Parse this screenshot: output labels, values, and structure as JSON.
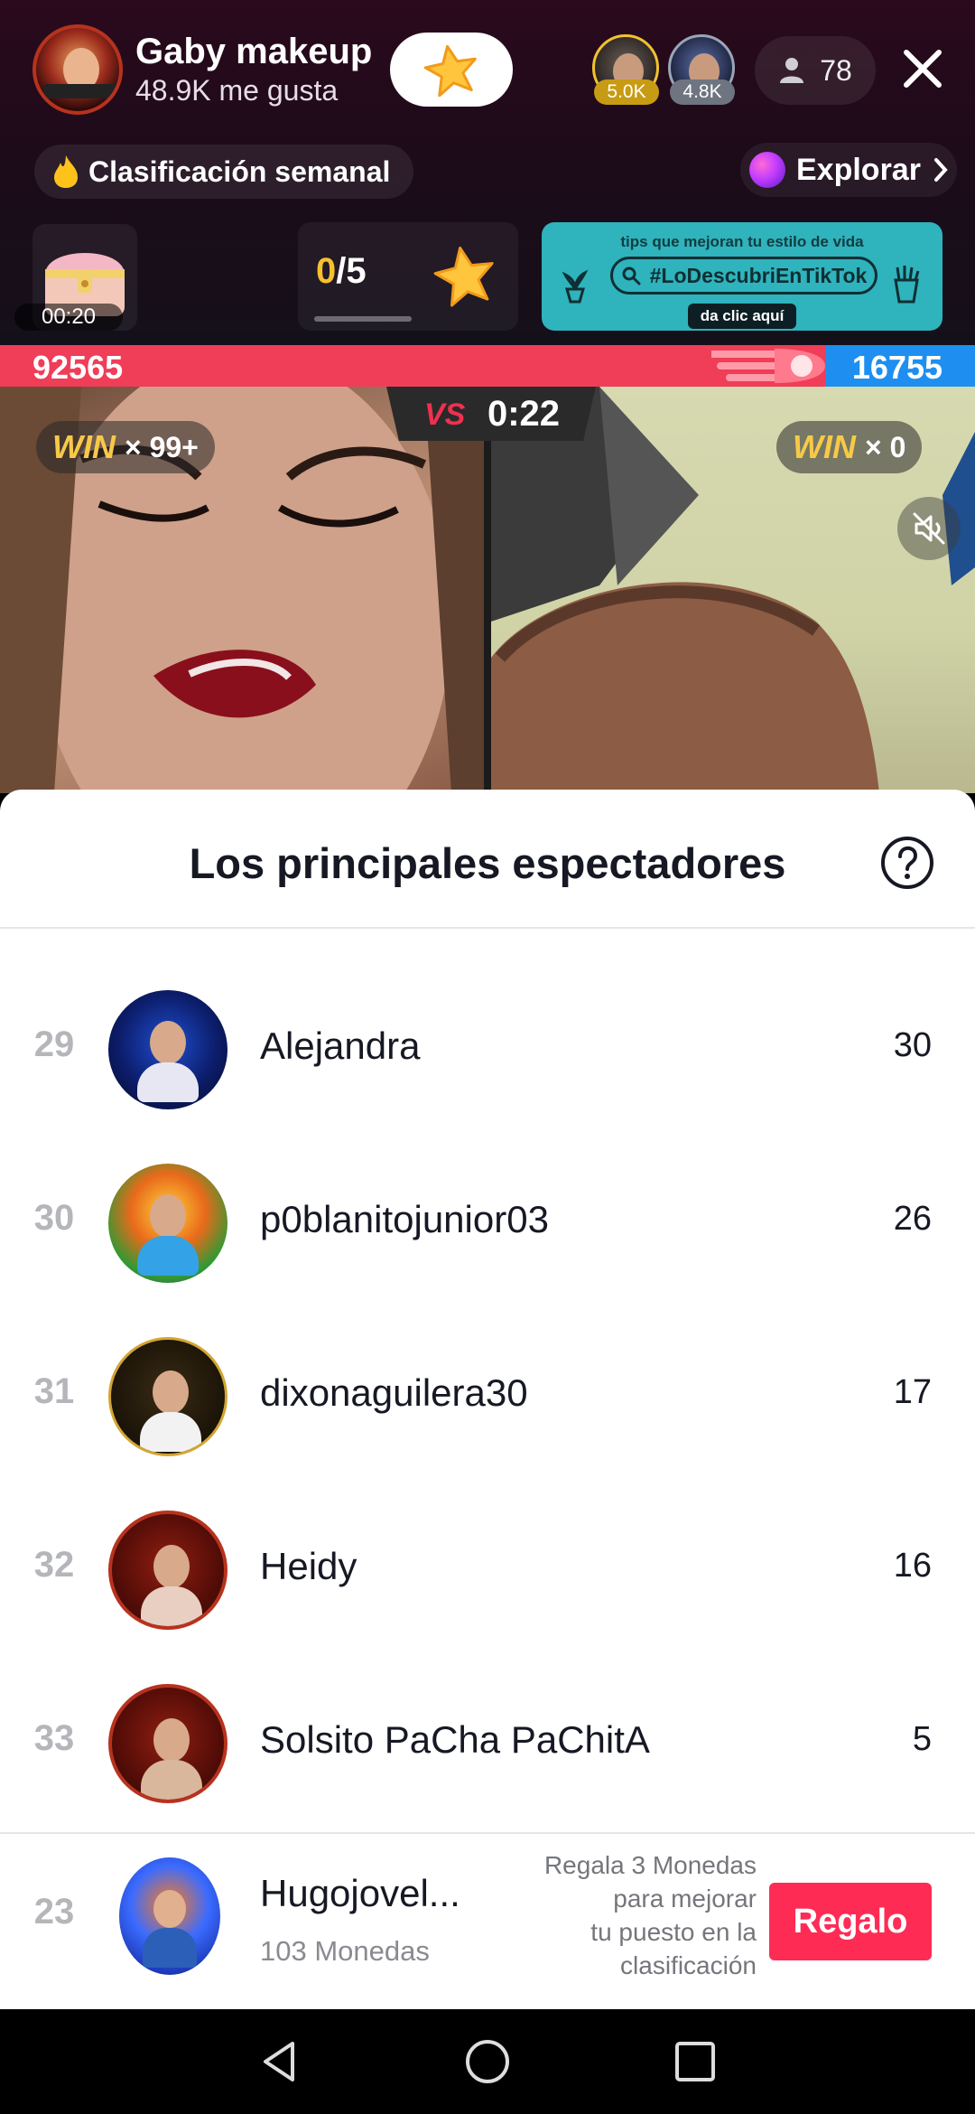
{
  "host": {
    "name": "Gaby makeup",
    "likes": "48.9K me gusta"
  },
  "top_viewers": [
    {
      "badge": "5.0K"
    },
    {
      "badge": "4.8K"
    }
  ],
  "viewer_count": "78",
  "weekly_ranking": "Clasificación semanal",
  "explore": "Explorar",
  "chest_timer": "00:20",
  "goal": {
    "current": "0",
    "total": "/5"
  },
  "promo": {
    "top_text": "tips que mejoran tu estilo de vida",
    "hashtag": "#LoDescubriEnTikTok",
    "cta": "da clic aquí"
  },
  "battle": {
    "left_score": "92565",
    "right_score": "16755",
    "left_share": 0.8466,
    "timer": "0:22",
    "vs": "VS",
    "left_win_label": "WIN",
    "left_win_count": "× 99+",
    "right_win_label": "WIN",
    "right_win_count": "× 0"
  },
  "sheet": {
    "title": "Los principales espectadores",
    "rows": [
      {
        "rank": "29",
        "name": "Alejandra",
        "score": "30"
      },
      {
        "rank": "30",
        "name": "p0blanitojunior03",
        "score": "26"
      },
      {
        "rank": "31",
        "name": "dixonaguilera30",
        "score": "17"
      },
      {
        "rank": "32",
        "name": "Heidy",
        "score": "16"
      },
      {
        "rank": "33",
        "name": "Solsito PaCha  PaChitA",
        "score": "5"
      }
    ],
    "self": {
      "rank": "23",
      "name": "Hugojovel...",
      "coins": "103 Monedas",
      "hint_lines": [
        "Regala 3 Monedas",
        "para mejorar",
        "tu puesto en la",
        "clasificación"
      ],
      "gift_button": "Regalo"
    }
  },
  "colors": {
    "accent": "#fe2c55",
    "battle_red": "#f03d58",
    "battle_blue": "#1e8ff0",
    "win_gold": "#f7c948"
  }
}
